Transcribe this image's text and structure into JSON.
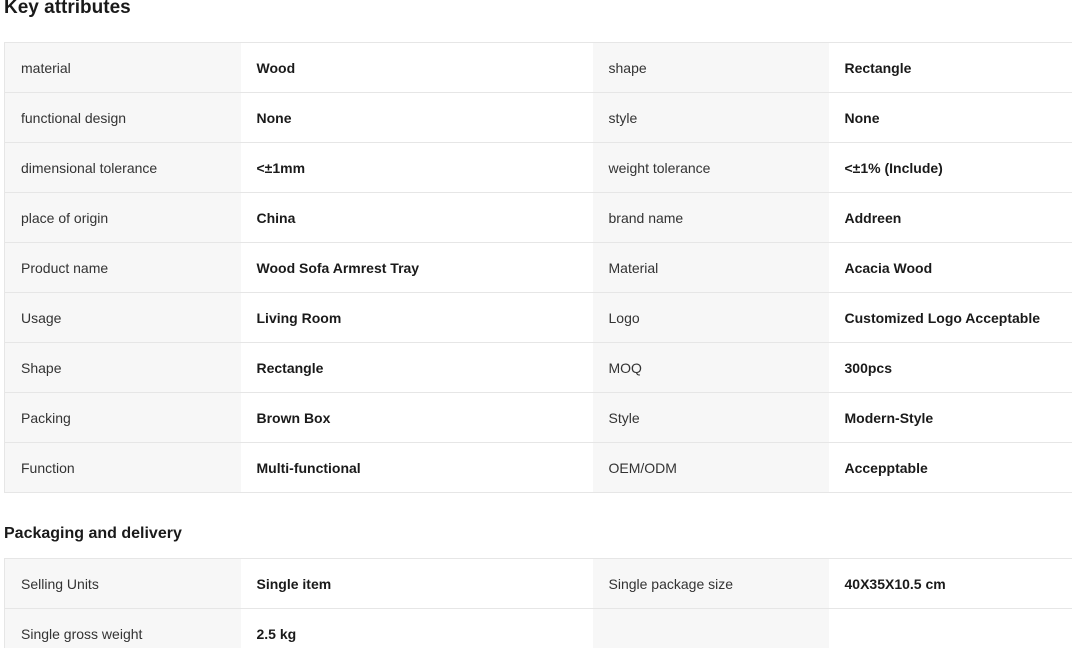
{
  "key_attributes": {
    "title": "Key attributes",
    "rows": [
      {
        "label1": "material",
        "value1": "Wood",
        "label2": "shape",
        "value2": "Rectangle"
      },
      {
        "label1": "functional design",
        "value1": "None",
        "label2": "style",
        "value2": "None"
      },
      {
        "label1": "dimensional tolerance",
        "value1": "<±1mm",
        "label2": "weight tolerance",
        "value2": "<±1% (Include)"
      },
      {
        "label1": "place of origin",
        "value1": "China",
        "label2": "brand name",
        "value2": "Addreen"
      },
      {
        "label1": "Product name",
        "value1": "Wood Sofa Armrest Tray",
        "label2": "Material",
        "value2": "Acacia Wood"
      },
      {
        "label1": "Usage",
        "value1": "Living Room",
        "label2": "Logo",
        "value2": "Customized Logo Acceptable"
      },
      {
        "label1": "Shape",
        "value1": "Rectangle",
        "label2": "MOQ",
        "value2": "300pcs"
      },
      {
        "label1": "Packing",
        "value1": "Brown Box",
        "label2": "Style",
        "value2": "Modern-Style"
      },
      {
        "label1": "Function",
        "value1": "Multi-functional",
        "label2": "OEM/ODM",
        "value2": "Accepptable"
      }
    ]
  },
  "packaging": {
    "title": "Packaging and delivery",
    "rows": [
      {
        "label1": "Selling Units",
        "value1": "Single item",
        "label2": "Single package size",
        "value2": "40X35X10.5 cm"
      },
      {
        "label1": "Single gross weight",
        "value1": "2.5 kg",
        "label2": "",
        "value2": ""
      }
    ]
  }
}
